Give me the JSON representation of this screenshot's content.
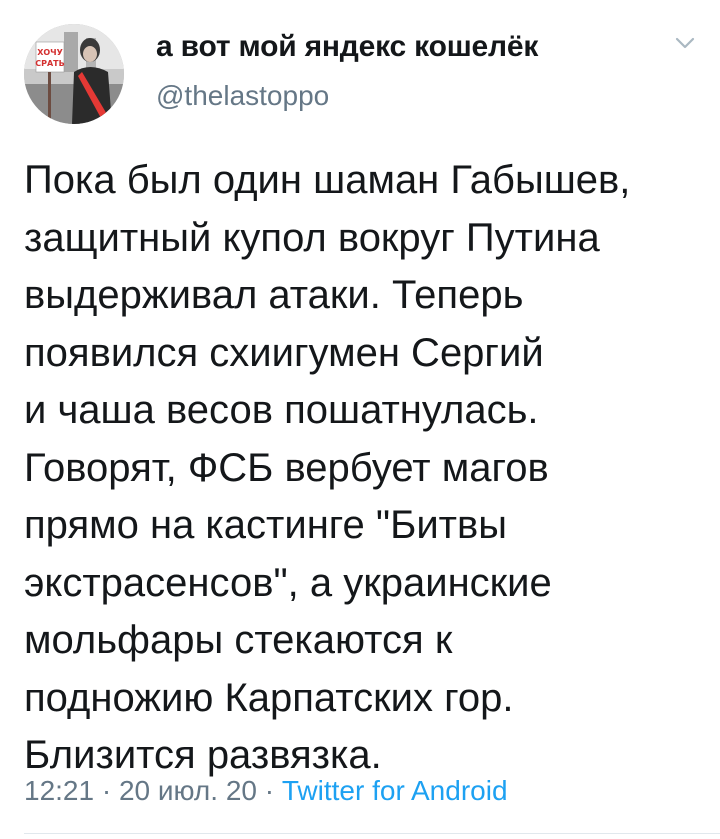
{
  "user": {
    "display_name": "а вот мой яндекс кошелёк",
    "handle": "@thelastoppo",
    "avatar_sign_text": "ХОЧУ СРАТЬ"
  },
  "tweet": {
    "lines": [
      "Пока был один шаман Габышев,",
      "защитный купол вокруг Путина",
      "выдерживал атаки. Теперь",
      "появился схиигумен Сергий",
      "и чаша весов пошатнулась.",
      "Говорят, ФСБ вербует магов",
      "прямо на кастинге \"Битвы",
      "экстрасенсов\", а украинские",
      "мольфары стекаются к",
      "подножию Карпатских гор.",
      "Близится развязка."
    ],
    "time": "12:21",
    "separator1": " · ",
    "date": "20 июл. 20",
    "separator2": " · ",
    "source": "Twitter for Android"
  },
  "icons": {
    "menu": "chevron-down-icon"
  },
  "colors": {
    "text_primary": "#14171a",
    "text_secondary": "#657786",
    "link": "#1da1f2",
    "divider": "#e1e8ed"
  }
}
